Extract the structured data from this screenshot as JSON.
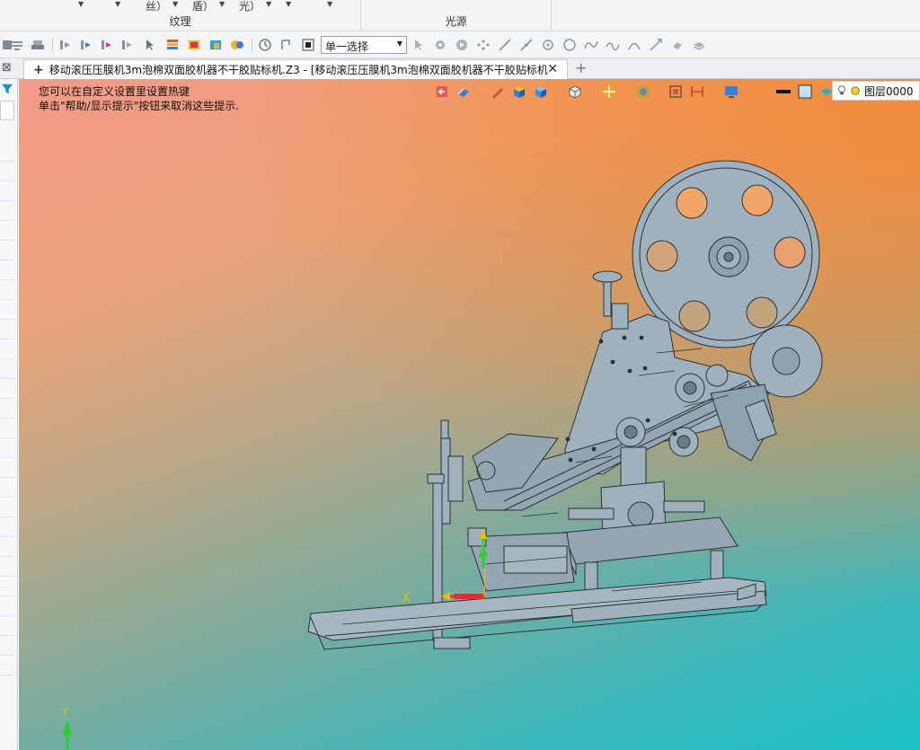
{
  "ribbon": {
    "fragments": [
      "丝）",
      "盾）",
      "光）"
    ],
    "groups": [
      {
        "label": "纹理"
      },
      {
        "label": "光源"
      }
    ]
  },
  "toolbar": {
    "selection_mode": "单一选择"
  },
  "tabs": {
    "active_title": "移动滚压压膜机3m泡棉双面胶机器不干胶贴标机.Z3 - [移动滚压压膜机3m泡棉双面胶机器不干胶贴标机]",
    "new_tab": "+",
    "close_glyph": "✕"
  },
  "viewport": {
    "hint_line1": "您可以在自定义设置里设置热键",
    "hint_line2": "单击\"帮助/显示提示\"按钮来取消这些提示.",
    "layer_name": "图层0000",
    "axis_x": "X",
    "axis_y": "Y",
    "colors": {
      "model_fill": "#9fb1bd",
      "model_edge": "#2b3137",
      "axis_x": "#e03030",
      "axis_y": "#2bd030",
      "axis_label": "#e8c000"
    }
  }
}
